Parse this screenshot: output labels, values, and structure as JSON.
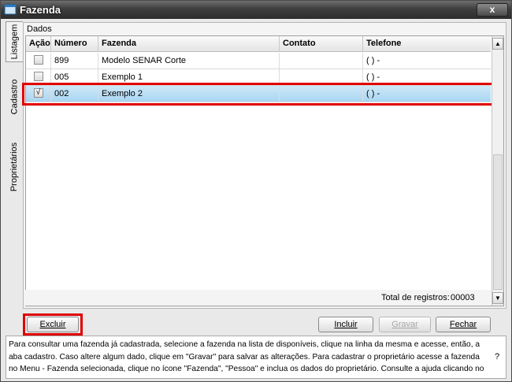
{
  "window": {
    "title": "Fazenda",
    "close_label": "x"
  },
  "side_tabs": [
    {
      "label": "Listagem"
    },
    {
      "label": "Cadastro"
    },
    {
      "label": "Proprietários"
    }
  ],
  "panel": {
    "label": "Dados"
  },
  "table": {
    "columns": [
      "Ação",
      "Número",
      "Fazenda",
      "Contato",
      "Telefone"
    ],
    "rows": [
      {
        "checked": false,
        "numero": "899",
        "fazenda": "Modelo SENAR Corte",
        "contato": "",
        "telefone": "( )  -"
      },
      {
        "checked": false,
        "numero": "005",
        "fazenda": "Exemplo 1",
        "contato": "",
        "telefone": "( )  -"
      },
      {
        "checked": true,
        "check_mark": "√",
        "numero": "002",
        "fazenda": "Exemplo 2",
        "contato": "",
        "telefone": "( )  -"
      }
    ],
    "selected_row": 2
  },
  "total": {
    "label": "Total de registros:",
    "value": "00003"
  },
  "buttons": {
    "excluir": "Excluir",
    "incluir": "Incluir",
    "gravar": "Gravar",
    "fechar": "Fechar"
  },
  "help": {
    "text": "Para consultar uma fazenda já cadastrada, selecione a fazenda na lista de disponíveis, clique na linha da mesma e acesse, então, a aba cadastro. Caso altere algum dado, clique em \"Gravar\" para salvar as alterações. Para cadastrar o proprietário acesse a fazenda no Menu - Fazenda selecionada, clique no ícone \"Fazenda\", \"Pessoa\" e inclua os dados do proprietário. Consulte a ajuda clicando no",
    "question": "?"
  },
  "colors": {
    "highlight": "#e00000",
    "selected_row": "#b5dcf4",
    "titlebar": "#3a3a3a"
  }
}
